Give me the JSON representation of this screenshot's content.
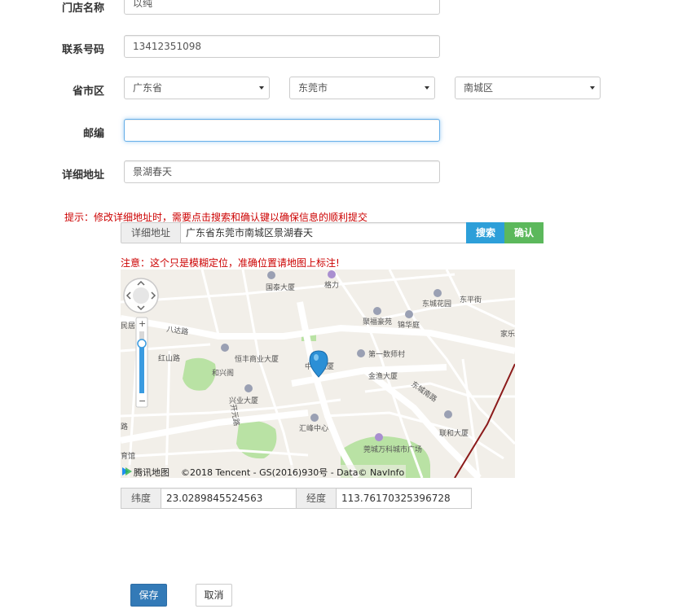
{
  "form": {
    "store_name": {
      "label": "门店名称",
      "value": "以纯"
    },
    "phone": {
      "label": "联系号码",
      "value": "13412351098"
    },
    "region": {
      "label": "省市区",
      "province": "广东省",
      "city": "东莞市",
      "district": "南城区"
    },
    "zip": {
      "label": "邮编",
      "value": ""
    },
    "address": {
      "label": "详细地址",
      "value": "景湖春天"
    }
  },
  "tip": "提示：修改详细地址时，需要点击搜索和确认键以确保信息的顺利提交",
  "search": {
    "addon": "详细地址",
    "value": "广东省东莞市南城区景湖春天",
    "search_label": "搜索",
    "confirm_label": "确认"
  },
  "notice": "注意：这个只是模糊定位，准确位置请地图上标注!",
  "map": {
    "labels": {
      "guotai": "国泰大厦",
      "gela": "格力",
      "dongcheng_garden": "东城花园",
      "dongping": "东平街",
      "jiale": "家乐",
      "minju": "民居",
      "bada": "八达路",
      "juyuan": "聚福豪苑",
      "jinghua": "锦华庭",
      "hengfeng": "恒丰商业大厦",
      "hongshan": "红山路",
      "hexing": "和兴阁",
      "zhongyi": "中义大厦",
      "diyi": "第一数师村",
      "jinyu": "金渔大厦",
      "dongcheng_south": "东城南路",
      "xingye": "兴业大厦",
      "huifeng": "汇峰中心",
      "lianhe": "联和大厦",
      "wanke": "莞城万科城市广场",
      "kaiyuan": "开元路",
      "yuguan": "育馆",
      "lu": "路"
    },
    "attribution_logo": "腾讯地图",
    "attribution": "©2018 Tencent - GS(2016)930号 - Data© NavInfo"
  },
  "coords": {
    "lat_label": "纬度",
    "lat_value": "23.0289845524563",
    "lng_label": "经度",
    "lng_value": "113.76170325396728"
  },
  "actions": {
    "save_label": "保存",
    "cancel_label": "取消"
  },
  "colors": {
    "tip_red": "#cc0000",
    "search_blue": "#2d9fd9",
    "confirm_green": "#5cb85c",
    "save_blue": "#337ab7",
    "focus_border": "#66afe9"
  }
}
